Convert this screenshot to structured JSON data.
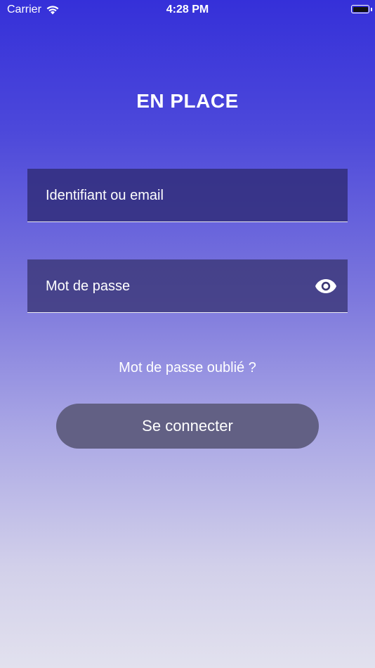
{
  "status_bar": {
    "carrier": "Carrier",
    "time": "4:28 PM",
    "icons": [
      "wifi-icon",
      "battery-icon"
    ]
  },
  "app": {
    "title": "EN PLACE"
  },
  "form": {
    "username_placeholder": "Identifiant ou email",
    "username_value": "",
    "password_placeholder": "Mot de passe",
    "password_value": "",
    "password_toggle_icon": "eye-icon",
    "forgot_password_label": "Mot de passe oublié ?",
    "login_button_label": "Se connecter"
  },
  "colors": {
    "gradient_top": "#3530d9",
    "gradient_bottom": "#e2e1ee",
    "button_bg": "#626084",
    "text": "#ffffff"
  }
}
